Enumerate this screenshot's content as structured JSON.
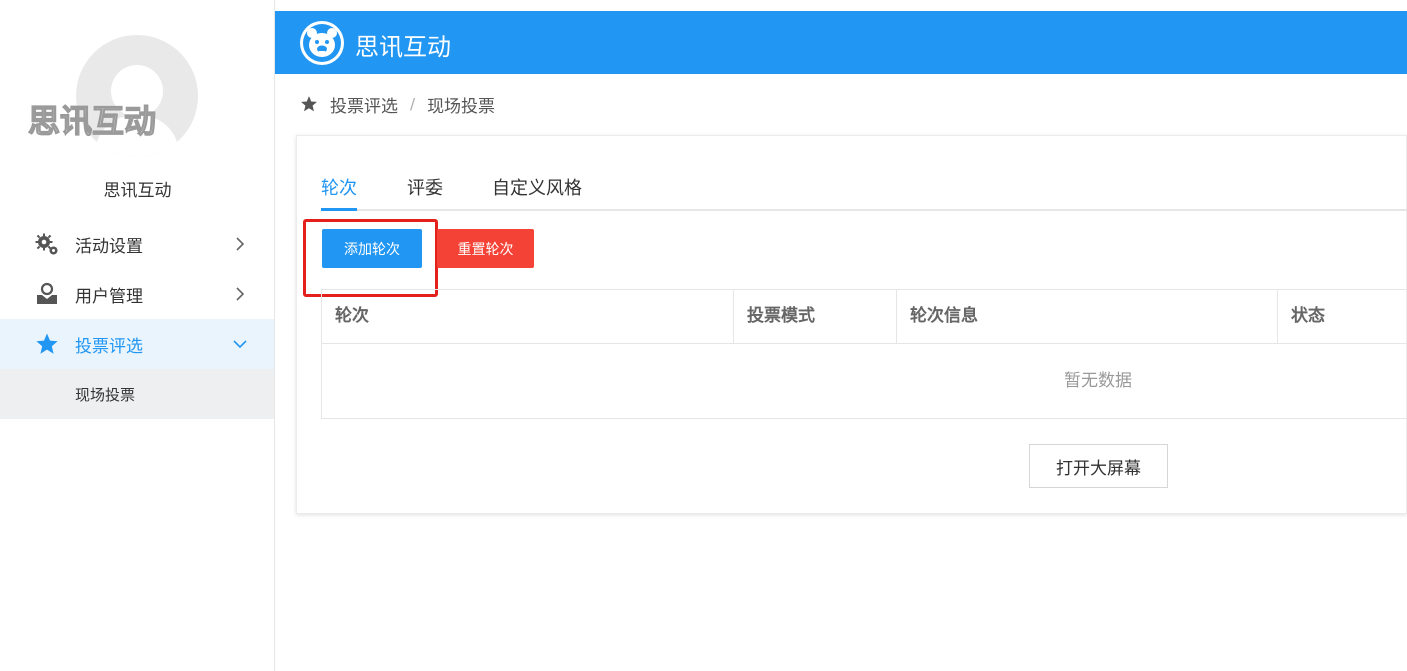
{
  "sidebar": {
    "avatar_watermark": "思讯互动",
    "username": "思讯互动",
    "menu": [
      {
        "label": "活动设置",
        "icon": "gears-icon",
        "expanded": false
      },
      {
        "label": "用户管理",
        "icon": "user-inbox-icon",
        "expanded": false
      },
      {
        "label": "投票评选",
        "icon": "star-icon",
        "expanded": true,
        "active": true
      }
    ],
    "submenu": [
      {
        "label": "现场投票"
      }
    ]
  },
  "header": {
    "title": "思讯互动",
    "logo_icon": "bear-logo-icon"
  },
  "breadcrumb": {
    "icon": "star-icon",
    "items": [
      "投票评选",
      "现场投票"
    ],
    "separator": "/"
  },
  "tabs": [
    {
      "label": "轮次",
      "active": true
    },
    {
      "label": "评委",
      "active": false
    },
    {
      "label": "自定义风格",
      "active": false
    }
  ],
  "toolbar": {
    "add_label": "添加轮次",
    "reset_label": "重置轮次"
  },
  "table": {
    "columns": [
      "轮次",
      "投票模式",
      "轮次信息",
      "状态"
    ],
    "empty_text": "暂无数据"
  },
  "open_screen_label": "打开大屏幕",
  "colors": {
    "primary": "#2196f3",
    "danger": "#f44336",
    "highlight": "#e3201b"
  }
}
